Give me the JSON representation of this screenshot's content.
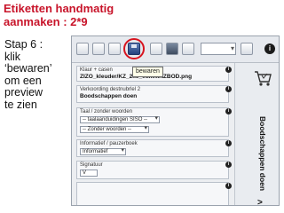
{
  "slide": {
    "title_line1": "Etiketten handmatig",
    "title_line2": "aanmaken : 2*9",
    "step_lines": [
      "Stap 6 :",
      "klik",
      "‘bewaren’",
      "om een",
      "preview",
      "te zien"
    ]
  },
  "toolbar": {
    "tooltip": "bewaren",
    "save_icon": "floppy-disk-icon",
    "zoom_value": "",
    "info_label": "i"
  },
  "panels": {
    "class": {
      "label": "Klaur + casen",
      "value": "ZIZO_kleuder/KZ_2x9_etikettNZBOD.png"
    },
    "link": {
      "label": "Verkoording destnubrlel 2",
      "value": "Boodschappen doen"
    },
    "text": {
      "label": "Taal / zonder woorden",
      "select1": "-- taalaanduidingen SISO --",
      "select2": "-- Zonder woorden --"
    },
    "info": {
      "label": "Informatief / pauzerboek",
      "select": "Informatief"
    },
    "signature": {
      "label": "Signatuur",
      "value": "V"
    }
  },
  "sidebar": {
    "title": "Boodschappen doen",
    "icon": "shopping-cart-icon",
    "bottom_icon": "info-icon",
    "bottom_arrow": ">"
  }
}
